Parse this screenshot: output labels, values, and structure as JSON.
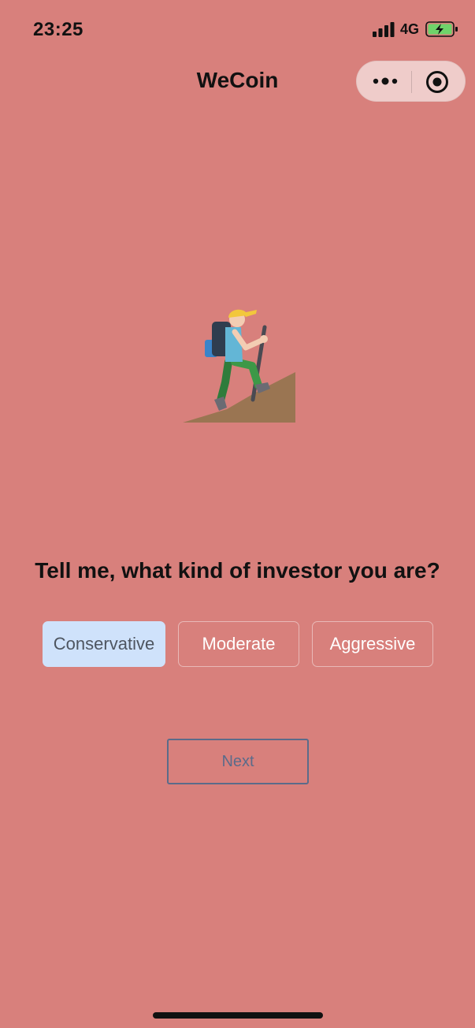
{
  "status_bar": {
    "time": "23:25",
    "network": "4G",
    "icons": [
      "signal-icon",
      "battery-charging-icon"
    ]
  },
  "nav": {
    "title": "WeCoin",
    "capsule_icons": [
      "more-icon",
      "close-target-icon"
    ]
  },
  "illustration": {
    "icon": "hiker-icon"
  },
  "question": "Tell me, what kind of investor you are?",
  "options": [
    {
      "label": "Conservative",
      "selected": true
    },
    {
      "label": "Moderate",
      "selected": false
    },
    {
      "label": "Aggressive",
      "selected": false
    }
  ],
  "next_label": "Next",
  "colors": {
    "background": "#d8807c",
    "selected_option_bg": "#cfe2fb",
    "next_border": "#5b6b8a"
  }
}
